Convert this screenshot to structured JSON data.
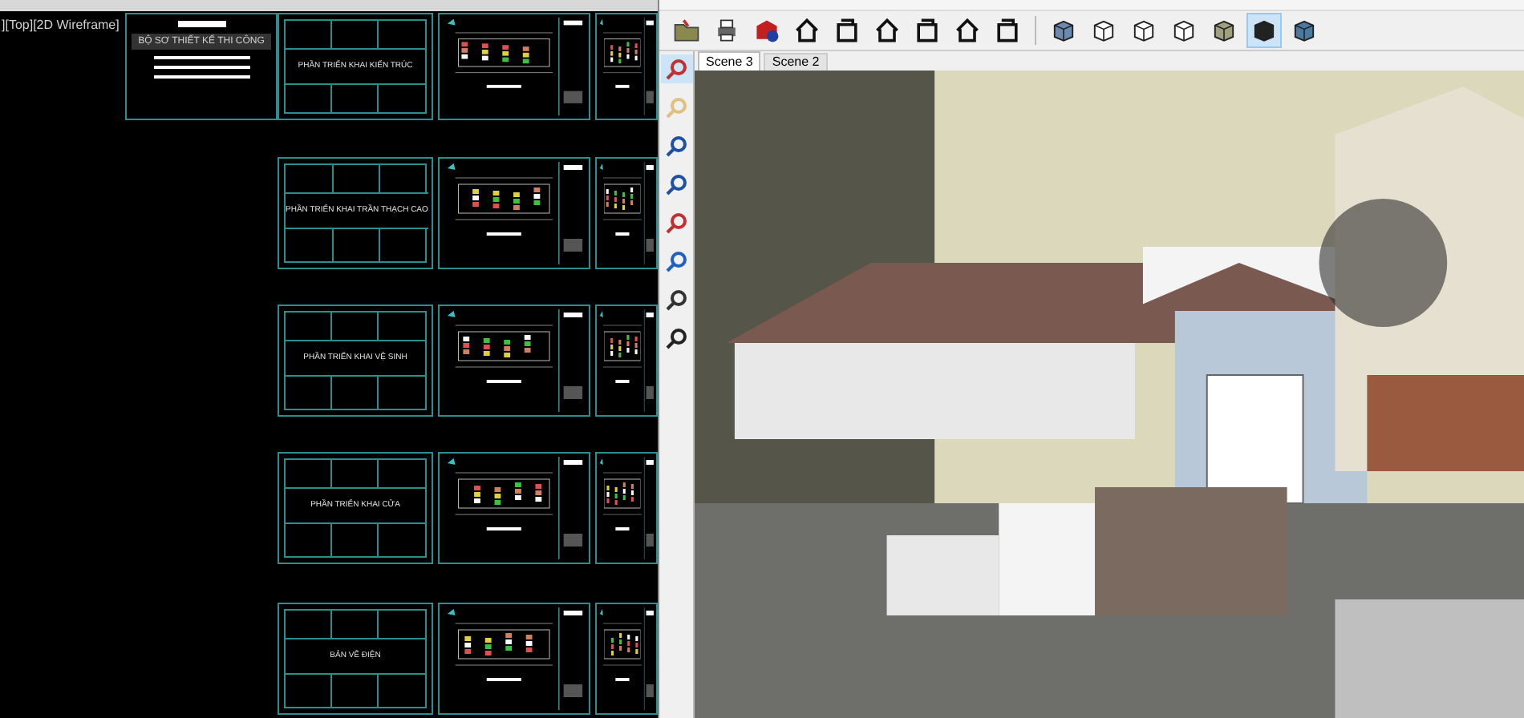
{
  "cad": {
    "viewport_label": "][Top][2D Wireframe]",
    "cover_title": "BỘ SƠ THIẾT KẾ THI CÔNG",
    "sheet_titles": [
      "PHẦN TRIỂN KHAI KIẾN TRÚC",
      "PHẦN TRIỂN KHAI TRẦN THẠCH CAO",
      "PHẦN TRIỂN KHAI VỆ SINH",
      "PHẦN TRIỂN KHAI CỬA",
      "BẢN VẼ ĐIỆN"
    ]
  },
  "sketchup": {
    "style_buttons": [
      {
        "selected": false
      },
      {
        "selected": false
      },
      {
        "selected": false
      },
      {
        "selected": false
      },
      {
        "selected": false
      },
      {
        "selected": true
      },
      {
        "selected": false
      }
    ],
    "scenes": [
      {
        "label": "Scene 3",
        "selected": true
      },
      {
        "label": "Scene 2",
        "selected": false
      }
    ],
    "side_tools": [
      {
        "selected": true
      },
      {
        "selected": false
      },
      {
        "selected": false
      },
      {
        "selected": false
      },
      {
        "selected": false
      },
      {
        "selected": false
      },
      {
        "selected": false
      },
      {
        "selected": false
      }
    ]
  }
}
